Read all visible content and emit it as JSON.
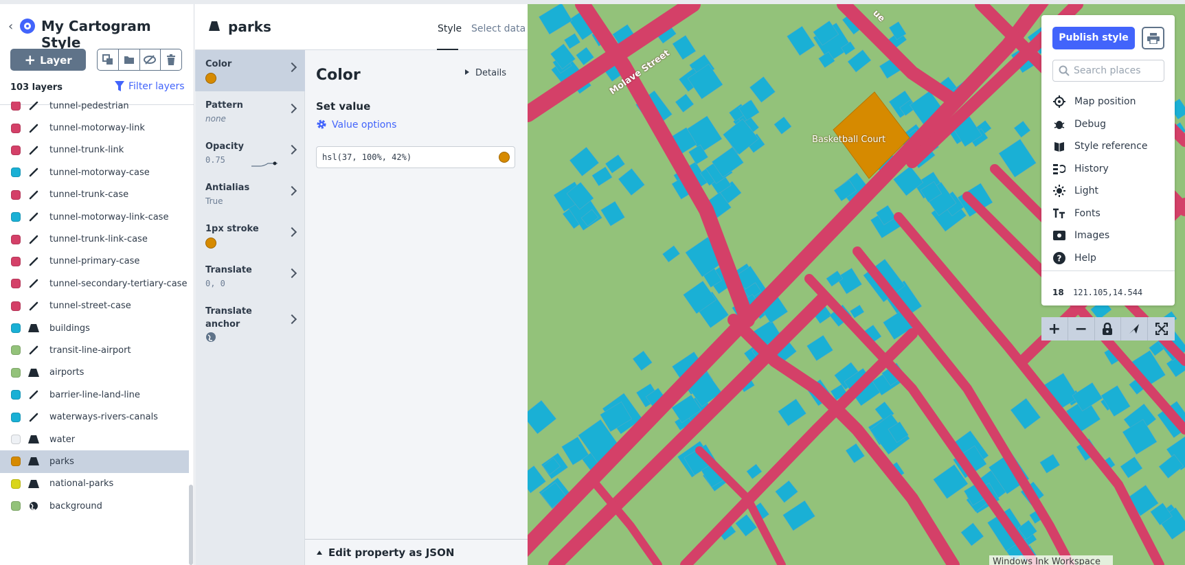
{
  "sidebar": {
    "style_name": "My Cartogram Style",
    "add_layer_label": "Layer",
    "layer_count": "103 layers",
    "filter_label": "Filter layers",
    "layers": [
      {
        "name": "tunnel-pedestrian",
        "color": "#d44068",
        "type": "line"
      },
      {
        "name": "tunnel-motorway-link",
        "color": "#d44068",
        "type": "line"
      },
      {
        "name": "tunnel-trunk-link",
        "color": "#d44068",
        "type": "line"
      },
      {
        "name": "tunnel-motorway-case",
        "color": "#1ab0d5",
        "type": "line"
      },
      {
        "name": "tunnel-trunk-case",
        "color": "#d44068",
        "type": "line"
      },
      {
        "name": "tunnel-motorway-link-case",
        "color": "#1ab0d5",
        "type": "line"
      },
      {
        "name": "tunnel-trunk-link-case",
        "color": "#d44068",
        "type": "line"
      },
      {
        "name": "tunnel-primary-case",
        "color": "#d44068",
        "type": "line"
      },
      {
        "name": "tunnel-secondary-tertiary-case",
        "color": "#d44068",
        "type": "line"
      },
      {
        "name": "tunnel-street-case",
        "color": "#d44068",
        "type": "line"
      },
      {
        "name": "buildings",
        "color": "#1ab0d5",
        "type": "fill"
      },
      {
        "name": "transit-line-airport",
        "color": "#93c27a",
        "type": "line"
      },
      {
        "name": "airports",
        "color": "#93c27a",
        "type": "fill"
      },
      {
        "name": "barrier-line-land-line",
        "color": "#1ab0d5",
        "type": "line"
      },
      {
        "name": "waterways-rivers-canals",
        "color": "#1ab0d5",
        "type": "line"
      },
      {
        "name": "water",
        "color": "#eef1f5",
        "type": "fill"
      },
      {
        "name": "parks",
        "color": "#d68a00",
        "type": "fill",
        "active": true
      },
      {
        "name": "national-parks",
        "color": "#d9d51a",
        "type": "fill"
      },
      {
        "name": "background",
        "color": "#93c27a",
        "type": "background"
      }
    ]
  },
  "properties": {
    "layer_name": "parks",
    "tabs": [
      "Style",
      "Select data"
    ],
    "items": [
      {
        "label": "Color",
        "value": "",
        "kind": "color"
      },
      {
        "label": "Pattern",
        "value": "none",
        "kind": "italic"
      },
      {
        "label": "Opacity",
        "value": "0.75",
        "kind": "mono"
      },
      {
        "label": "Antialias",
        "value": "True",
        "kind": "text"
      },
      {
        "label": "1px stroke",
        "value": "",
        "kind": "color"
      },
      {
        "label": "Translate",
        "value": "0, 0",
        "kind": "mono"
      },
      {
        "label": "Translate anchor",
        "value": "",
        "kind": "globe"
      }
    ]
  },
  "editor": {
    "title": "Color",
    "details_label": "Details",
    "set_value_label": "Set value",
    "value_options_label": "Value options",
    "color_value": "hsl(37, 100%, 42%)",
    "edit_json_label": "Edit property as JSON"
  },
  "map": {
    "street_labels": [
      "Molave Street",
      "ue"
    ],
    "feature_label": "Basketball Court",
    "ink_workspace": "Windows Ink Workspace",
    "colors": {
      "land": "#93c27a",
      "roads": "#d44068",
      "buildings": "#1ab0d5",
      "park": "#d68a00"
    }
  },
  "toolbar": {
    "publish_label": "Publish style",
    "search_placeholder": "Search places",
    "items": [
      "Map position",
      "Debug",
      "Style reference",
      "History",
      "Light",
      "Fonts",
      "Images",
      "Help"
    ],
    "zoom": "18",
    "coordinates": "121.105,14.544"
  },
  "map_controls": [
    "+",
    "−"
  ]
}
